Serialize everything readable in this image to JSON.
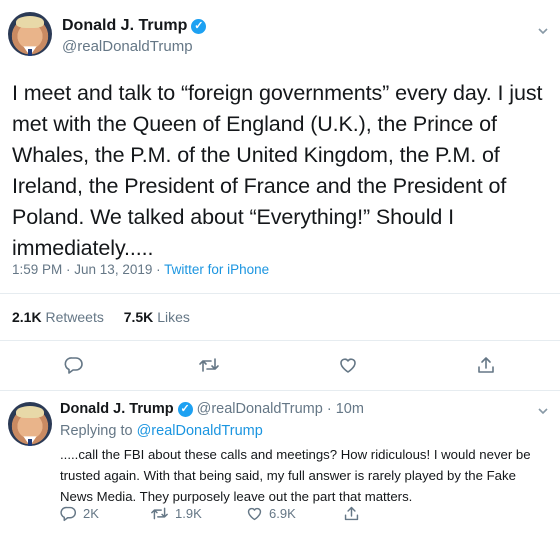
{
  "tweet": {
    "author_name": "Donald J. Trump",
    "author_handle": "@realDonaldTrump",
    "text": "I meet and talk to “foreign governments” every day. I just met with the Queen of England (U.K.), the Prince of Whales, the P.M. of the United Kingdom, the P.M. of Ireland, the President of France and the President of Poland. We talked about “Everything!” Should I immediately.....",
    "time": "1:59 PM",
    "separator": " · ",
    "date": "Jun 13, 2019",
    "source": "Twitter for iPhone",
    "retweets_count": "2.1K",
    "retweets_label": "Retweets",
    "likes_count": "7.5K",
    "likes_label": "Likes"
  },
  "reply": {
    "author_name": "Donald J. Trump",
    "author_handle": "@realDonaldTrump",
    "time_sep": " · ",
    "time": "10m",
    "replying_prefix": "Replying to ",
    "replying_to": "@realDonaldTrump",
    "text": ".....call the FBI about these calls and meetings? How ridiculous! I would never be trusted again. With that being said, my full answer is rarely played by the Fake News Media. They purposely leave out the part that matters.",
    "reply_count": "2K",
    "retweet_count": "1.9K",
    "like_count": "6.9K"
  },
  "icons": {
    "verified": "verified-badge-icon",
    "reply": "reply-icon",
    "retweet": "retweet-icon",
    "like": "heart-icon",
    "share": "share-icon",
    "menu": "chevron-down-icon"
  },
  "colors": {
    "link": "#1b95e0",
    "verified": "#1da1f2",
    "muted": "#657786",
    "icon": "#657786"
  }
}
